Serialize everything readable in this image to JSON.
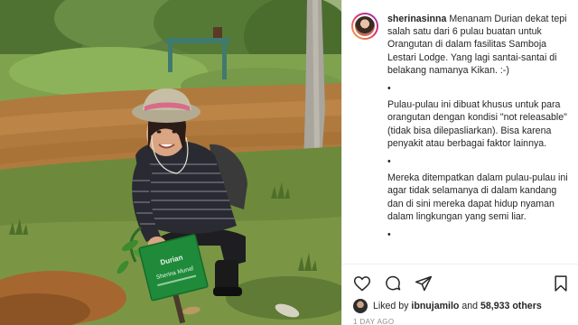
{
  "post": {
    "username": "sherinasinna",
    "caption_intro": "Menanam Durian dekat tepi salah satu dari 6 pulau buatan untuk Orangutan di dalam fasilitas Samboja Lestari Lodge. Yang lagi santai-santai di belakang namanya Kikan. :-)",
    "bullet_1": "•",
    "caption_para_2": "Pulau-pulau ini dibuat khusus untuk para orangutan dengan kondisi \"not releasable\" (tidak bisa dilepasliarkan). Bisa karena penyakit atau berbagai faktor lainnya.",
    "bullet_2": "•",
    "caption_para_3": "Mereka ditempatkan dalam pulau-pulau ini agar tidak selamanya di dalam kandang dan di sini mereka dapat hidup nyaman dalam lingkungan yang semi liar.",
    "bullet_3": "•"
  },
  "actions": {
    "like_icon": "heart-icon",
    "comment_icon": "comment-icon",
    "share_icon": "share-icon",
    "save_icon": "bookmark-icon"
  },
  "likes": {
    "prefix": "Liked by",
    "user": "ibnujamilo",
    "connector": "and",
    "others": "58,933 others"
  },
  "timestamp": "1 DAY AGO",
  "photo": {
    "sign_text_1": "Durian",
    "sign_text_2": "Sherina Munaf"
  },
  "colors": {
    "text": "#262626",
    "muted": "#8e8e8e",
    "divider": "#efefef",
    "sign_green": "#1f8a3a"
  }
}
